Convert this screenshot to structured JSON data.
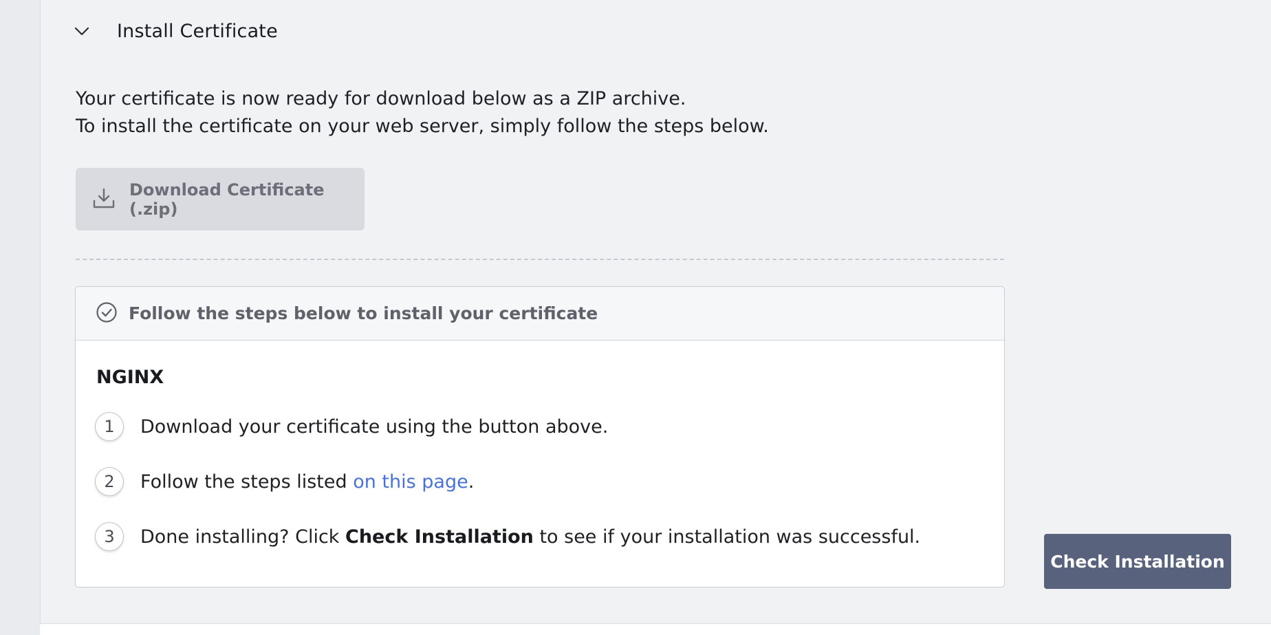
{
  "section": {
    "title": "Install Certificate"
  },
  "intro": {
    "line1": "Your certificate is now ready for download below as a ZIP archive.",
    "line2": "To install the certificate on your web server, simply follow the steps below."
  },
  "download_button": {
    "label": "Download Certificate (.zip)",
    "icon": "download-icon"
  },
  "steps_card": {
    "header": "Follow the steps below to install your certificate",
    "header_icon": "check-circle-icon",
    "platform": "NGINX",
    "steps": [
      {
        "number": "1",
        "text": "Download your certificate using the button above."
      },
      {
        "number": "2",
        "text_before": "Follow the steps listed ",
        "link": "on this page",
        "text_after": "."
      },
      {
        "number": "3",
        "text_before": "Done installing? Click ",
        "strong": "Check Installation",
        "text_after": " to see if your installation was successful."
      }
    ]
  },
  "check_button": {
    "label": "Check Installation"
  },
  "colors": {
    "primary_button": "#59627c",
    "link": "#4a72d6",
    "disabled_button": "#d9dbe0"
  }
}
